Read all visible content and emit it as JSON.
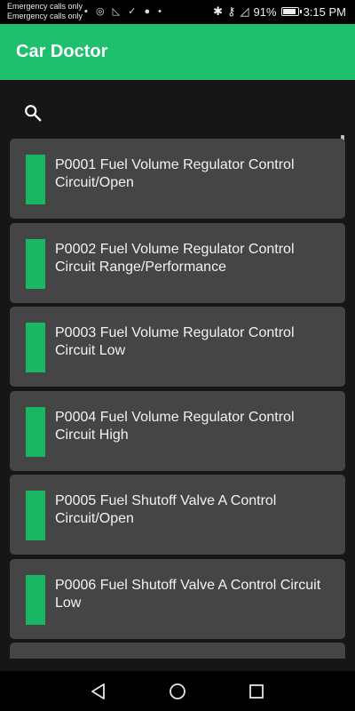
{
  "status_bar": {
    "carrier_line1": "Emergency calls only",
    "carrier_line2": "Emergency calls only",
    "battery": "91%",
    "time": "3:15 PM",
    "icons": [
      "vpn-icon",
      "alarm-icon",
      "signal-icon",
      "bluetooth-icon",
      "key-icon",
      "wifi-icon",
      "battery-icon"
    ]
  },
  "app_bar": {
    "title": "Car Doctor",
    "color": "#1ebf6d"
  },
  "search": {
    "icon": "search-icon"
  },
  "list": {
    "accent_color": "#19b764",
    "items": [
      {
        "text": "P0001 Fuel Volume Regulator Control Circuit/Open"
      },
      {
        "text": "P0002 Fuel Volume Regulator Control Circuit Range/Performance"
      },
      {
        "text": "P0003 Fuel Volume Regulator Control Circuit Low"
      },
      {
        "text": "P0004 Fuel Volume Regulator Control Circuit High"
      },
      {
        "text": "P0005 Fuel Shutoff Valve A Control Circuit/Open"
      },
      {
        "text": "P0006 Fuel Shutoff Valve A Control Circuit Low"
      },
      {
        "text": ""
      }
    ]
  },
  "nav_bar": {
    "buttons": [
      "back-icon",
      "home-icon",
      "recents-icon"
    ]
  }
}
